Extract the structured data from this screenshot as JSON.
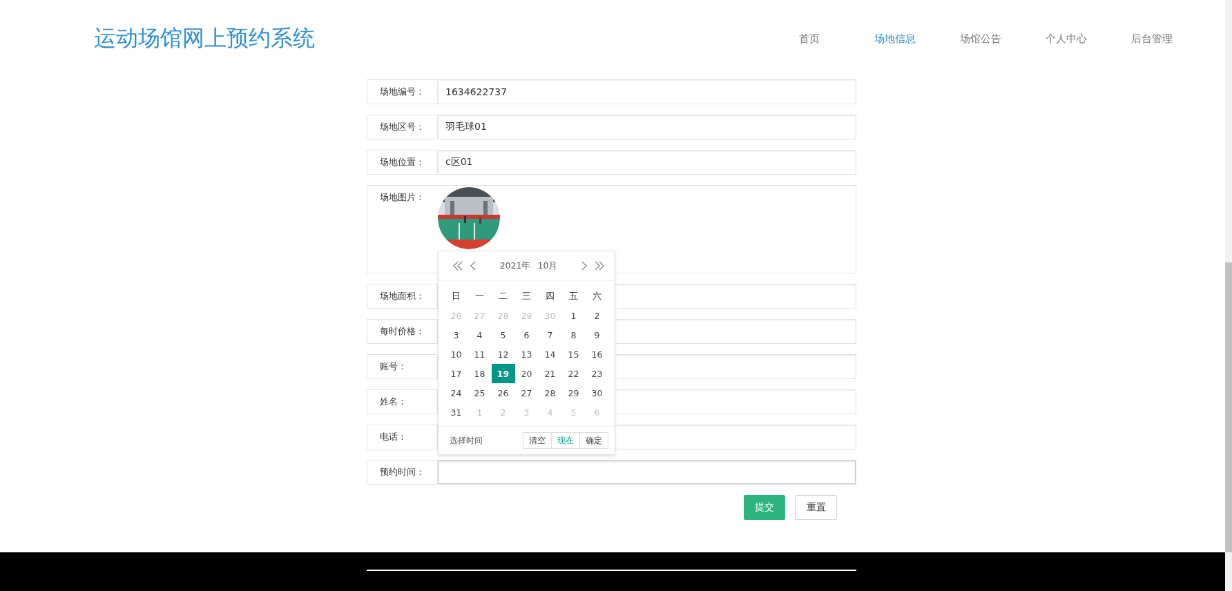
{
  "header": {
    "title": "运动场馆网上预约系统",
    "nav": [
      {
        "label": "首页",
        "selected": false
      },
      {
        "label": "场地信息",
        "selected": true
      },
      {
        "label": "场馆公告",
        "selected": false
      },
      {
        "label": "个人中心",
        "selected": false
      },
      {
        "label": "后台管理",
        "selected": false
      }
    ]
  },
  "form": {
    "fields": [
      {
        "kind": "text",
        "label": "场地编号：",
        "value": "1634622737"
      },
      {
        "kind": "text",
        "label": "场地区号：",
        "value": "羽毛球01"
      },
      {
        "kind": "text",
        "label": "场地位置：",
        "value": "c区01"
      },
      {
        "label": "场地图片："
      },
      {
        "kind": "text",
        "label": "场地面积："
      },
      {
        "kind": "text",
        "label": "每时价格："
      },
      {
        "kind": "text",
        "label": "账号："
      },
      {
        "kind": "text",
        "label": "姓名："
      },
      {
        "kind": "text",
        "label": "电话："
      },
      {
        "kind": "text",
        "label": "预约时间：",
        "focused": true
      }
    ],
    "buttons": [
      {
        "kind": "primary",
        "label": "提交"
      },
      {
        "kind": "default",
        "label": "重置"
      }
    ]
  },
  "date_picker": {
    "year": "2021年",
    "month": "10月",
    "weekdays": [
      "日",
      "一",
      "二",
      "三",
      "四",
      "五",
      "六"
    ],
    "weeks": [
      [
        {
          "label": "26",
          "other_month": true,
          "selected": false
        },
        {
          "label": "27",
          "other_month": true,
          "selected": false
        },
        {
          "label": "28",
          "other_month": true,
          "selected": false
        },
        {
          "label": "29",
          "other_month": true,
          "selected": false
        },
        {
          "label": "30",
          "other_month": true,
          "selected": false
        },
        {
          "label": "1",
          "other_month": false,
          "selected": false
        },
        {
          "label": "2",
          "other_month": false,
          "selected": false
        }
      ],
      [
        {
          "label": "3",
          "other_month": false,
          "selected": false
        },
        {
          "label": "4",
          "other_month": false,
          "selected": false
        },
        {
          "label": "5",
          "other_month": false,
          "selected": false
        },
        {
          "label": "6",
          "other_month": false,
          "selected": false
        },
        {
          "label": "7",
          "other_month": false,
          "selected": false
        },
        {
          "label": "8",
          "other_month": false,
          "selected": false
        },
        {
          "label": "9",
          "other_month": false,
          "selected": false
        }
      ],
      [
        {
          "label": "10",
          "other_month": false,
          "selected": false
        },
        {
          "label": "11",
          "other_month": false,
          "selected": false
        },
        {
          "label": "12",
          "other_month": false,
          "selected": false
        },
        {
          "label": "13",
          "other_month": false,
          "selected": false
        },
        {
          "label": "14",
          "other_month": false,
          "selected": false
        },
        {
          "label": "15",
          "other_month": false,
          "selected": false
        },
        {
          "label": "16",
          "other_month": false,
          "selected": false
        }
      ],
      [
        {
          "label": "17",
          "other_month": false,
          "selected": false
        },
        {
          "label": "18",
          "other_month": false,
          "selected": false
        },
        {
          "label": "19",
          "other_month": false,
          "selected": true
        },
        {
          "label": "20",
          "other_month": false,
          "selected": false
        },
        {
          "label": "21",
          "other_month": false,
          "selected": false
        },
        {
          "label": "22",
          "other_month": false,
          "selected": false
        },
        {
          "label": "23",
          "other_month": false,
          "selected": false
        }
      ],
      [
        {
          "label": "24",
          "other_month": false,
          "selected": false
        },
        {
          "label": "25",
          "other_month": false,
          "selected": false
        },
        {
          "label": "26",
          "other_month": false,
          "selected": false
        },
        {
          "label": "27",
          "other_month": false,
          "selected": false
        },
        {
          "label": "28",
          "other_month": false,
          "selected": false
        },
        {
          "label": "29",
          "other_month": false,
          "selected": false
        },
        {
          "label": "30",
          "other_month": false,
          "selected": false
        }
      ],
      [
        {
          "label": "31",
          "other_month": false,
          "selected": false
        },
        {
          "label": "1",
          "other_month": true,
          "selected": false
        },
        {
          "label": "2",
          "other_month": true,
          "selected": false
        },
        {
          "label": "3",
          "other_month": true,
          "selected": false
        },
        {
          "label": "4",
          "other_month": true,
          "selected": false
        },
        {
          "label": "5",
          "other_month": true,
          "selected": false
        },
        {
          "label": "6",
          "other_month": true,
          "selected": false
        }
      ]
    ],
    "footer_label": "选择时间",
    "actions": [
      {
        "label": "清空",
        "hovered": false
      },
      {
        "label": "现在",
        "hovered": true
      },
      {
        "label": "确定",
        "hovered": false
      }
    ]
  }
}
